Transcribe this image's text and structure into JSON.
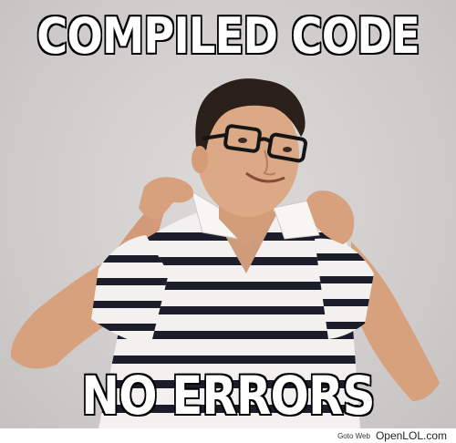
{
  "meme": {
    "top_text": "COMPILED CODE",
    "bottom_text": "NO ERRORS"
  },
  "watermark": {
    "goto_label": "Goto Web",
    "site": "OpenLOL.com"
  },
  "colors": {
    "background": "#d6d3d2",
    "caption_fill": "#ffffff",
    "caption_stroke": "#000000",
    "shirt_white": "#f3f1ef",
    "shirt_stripe": "#1c1d2a",
    "skin": "#d9a583",
    "hair": "#2a1f19"
  }
}
